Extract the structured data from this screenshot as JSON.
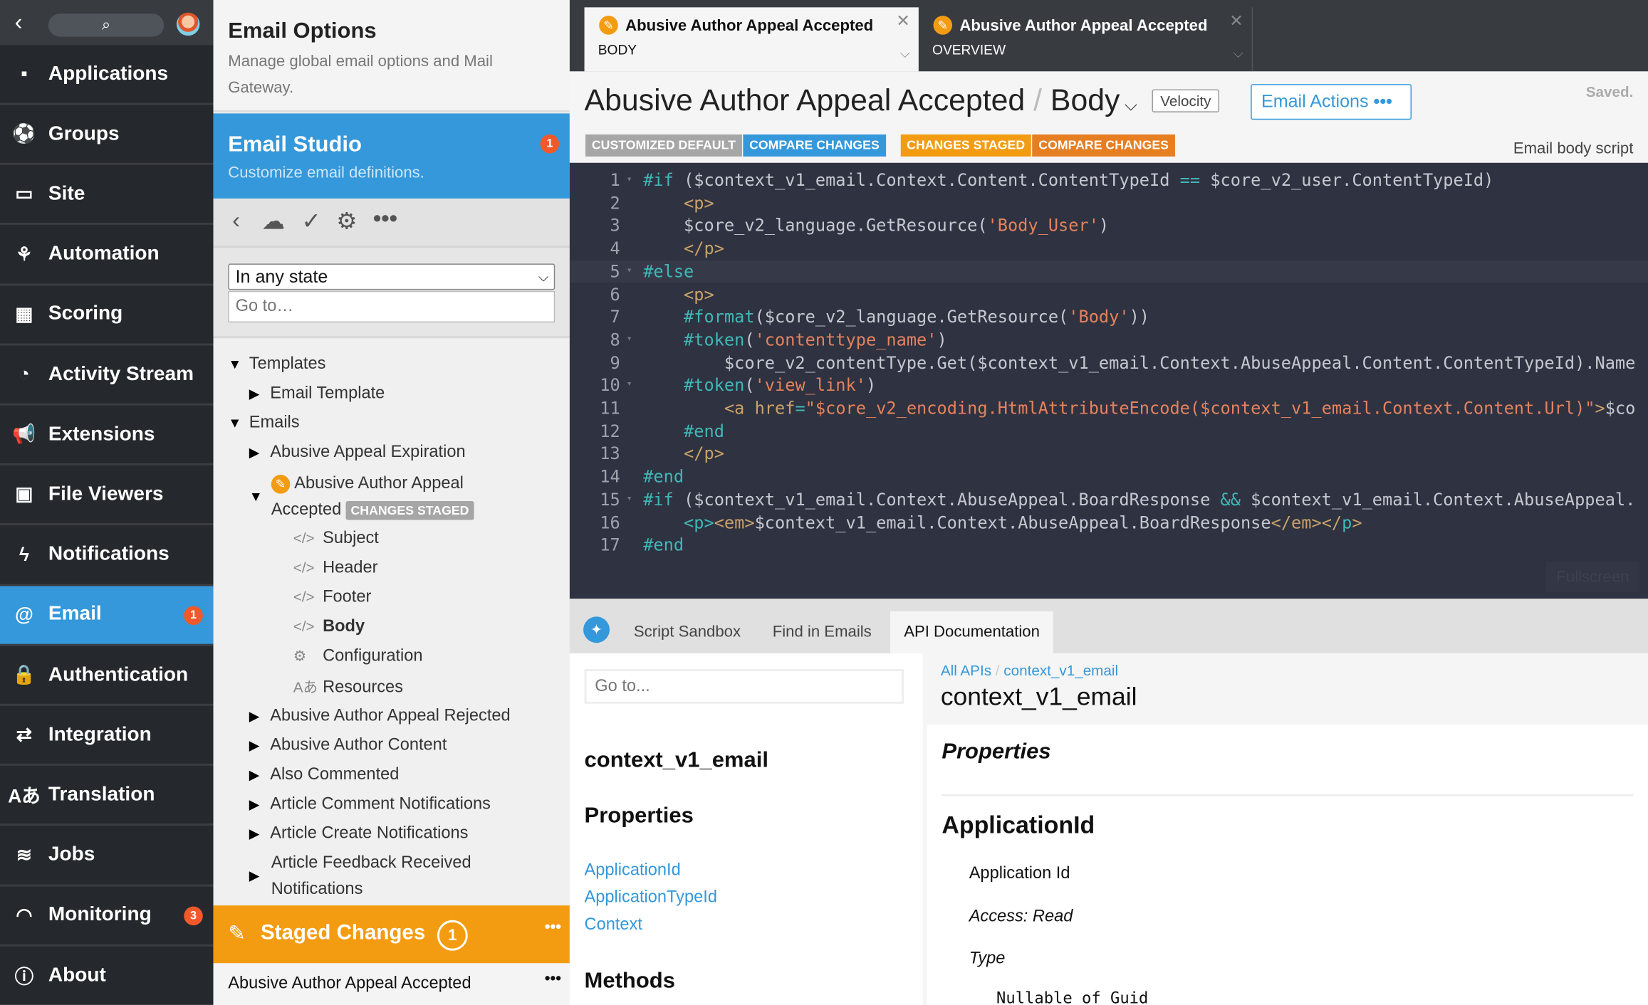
{
  "sidebar": {
    "items": [
      {
        "label": "Applications",
        "icon": "grid-icon",
        "glyph": "▪"
      },
      {
        "label": "Groups",
        "icon": "globe-icon",
        "glyph": "⚽"
      },
      {
        "label": "Site",
        "icon": "window-icon",
        "glyph": "▭"
      },
      {
        "label": "Automation",
        "icon": "hierarchy-icon",
        "glyph": "⚘"
      },
      {
        "label": "Scoring",
        "icon": "calculator-icon",
        "glyph": "▦"
      },
      {
        "label": "Activity Stream",
        "icon": "dashboard-icon",
        "glyph": "◔"
      },
      {
        "label": "Extensions",
        "icon": "megaphone-icon",
        "glyph": "📢"
      },
      {
        "label": "File Viewers",
        "icon": "camera-icon",
        "glyph": "▣"
      },
      {
        "label": "Notifications",
        "icon": "bolt-icon",
        "glyph": "ϟ"
      },
      {
        "label": "Email",
        "icon": "at-icon",
        "glyph": "@",
        "badge": "1",
        "active": true
      },
      {
        "label": "Authentication",
        "icon": "lock-icon",
        "glyph": "🔒"
      },
      {
        "label": "Integration",
        "icon": "shuffle-icon",
        "glyph": "⇄"
      },
      {
        "label": "Translation",
        "icon": "translate-icon",
        "glyph": "Aあ"
      },
      {
        "label": "Jobs",
        "icon": "database-icon",
        "glyph": "≋"
      },
      {
        "label": "Monitoring",
        "icon": "gauge-icon",
        "glyph": "◠",
        "badge": "3"
      },
      {
        "label": "About",
        "icon": "info-icon",
        "glyph": "ⓘ"
      }
    ]
  },
  "panel": {
    "title": "Email Options",
    "description": "Manage global email options and Mail Gateway.",
    "studio_title": "Email Studio",
    "studio_subtitle": "Customize email definitions.",
    "studio_badge": "1",
    "state_select": "In any state",
    "goto_placeholder": "Go to…",
    "tree": [
      {
        "label": "Templates",
        "level": 0,
        "toggle": "▼"
      },
      {
        "label": "Email Template",
        "level": 1,
        "toggle": "▶"
      },
      {
        "label": "Emails",
        "level": 0,
        "toggle": "▼"
      },
      {
        "label": "Abusive Appeal Expiration",
        "level": 1,
        "toggle": "▶"
      }
    ],
    "current_email": {
      "line1": "Abusive Author Appeal",
      "line2": "Accepted",
      "tag": "CHANGES STAGED"
    },
    "children": [
      {
        "label": "Subject",
        "icon": "code-icon",
        "glyph": "</>"
      },
      {
        "label": "Header",
        "icon": "code-icon",
        "glyph": "</>"
      },
      {
        "label": "Footer",
        "icon": "code-icon",
        "glyph": "</>"
      },
      {
        "label": "Body",
        "icon": "code-icon",
        "glyph": "</>",
        "bold": true
      },
      {
        "label": "Configuration",
        "icon": "gear-icon",
        "glyph": "⚙"
      },
      {
        "label": "Resources",
        "icon": "translate-icon",
        "glyph": "Aあ"
      }
    ],
    "more_emails": [
      "Abusive Author Appeal Rejected",
      "Abusive Author Content",
      "Also Commented",
      "Article Comment Notifications",
      "Article Create Notifications"
    ],
    "last_email": {
      "line1": "Article Feedback Received",
      "line2": "Notifications"
    },
    "staged": {
      "label": "Staged Changes",
      "count": "1",
      "item": "Abusive Author Appeal Accepted"
    }
  },
  "tabs": [
    {
      "title": "Abusive Author Appeal Accepted",
      "sub": "BODY",
      "active": true
    },
    {
      "title": "Abusive Author Appeal Accepted",
      "sub": "OVERVIEW"
    }
  ],
  "editor": {
    "title": "Abusive Author Appeal Accepted",
    "sep": "/",
    "section": "Body",
    "language": "Velocity",
    "actions": "Email Actions",
    "saved": "Saved.",
    "description": "Email body script",
    "pills": [
      {
        "label": "CUSTOMIZED DEFAULT",
        "color": "#a6a6a6"
      },
      {
        "label": "COMPARE CHANGES",
        "color": "#3498db"
      },
      {
        "label": "CHANGES STAGED",
        "color": "#f39c12"
      },
      {
        "label": "COMPARE CHANGES",
        "color": "#e67e22"
      }
    ],
    "fullscreen": "Fullscreen",
    "lines": [
      {
        "n": "1",
        "fold": true,
        "tok": [
          [
            "k",
            "#if"
          ],
          [
            "t",
            " ($context_v1_email.Context.Content.ContentTypeId "
          ],
          [
            "k",
            "=="
          ],
          [
            "t",
            " $core_v2_user.ContentTypeId)"
          ]
        ]
      },
      {
        "n": "2",
        "tok": [
          [
            "t",
            "    "
          ],
          [
            "g",
            "<p>"
          ]
        ]
      },
      {
        "n": "3",
        "tok": [
          [
            "t",
            "    $core_v2_language.GetResource("
          ],
          [
            "s",
            "'Body_User'"
          ],
          [
            "t",
            ")"
          ]
        ]
      },
      {
        "n": "4",
        "tok": [
          [
            "t",
            "    "
          ],
          [
            "g",
            "</p>"
          ]
        ]
      },
      {
        "n": "5",
        "fold": true,
        "hl": true,
        "tok": [
          [
            "k",
            "#else"
          ]
        ]
      },
      {
        "n": "6",
        "tok": [
          [
            "t",
            "    "
          ],
          [
            "g",
            "<p>"
          ]
        ]
      },
      {
        "n": "7",
        "tok": [
          [
            "t",
            "    "
          ],
          [
            "k",
            "#format"
          ],
          [
            "t",
            "($core_v2_language.GetResource("
          ],
          [
            "s",
            "'Body'"
          ],
          [
            "t",
            "))"
          ]
        ]
      },
      {
        "n": "8",
        "fold": true,
        "tok": [
          [
            "t",
            "    "
          ],
          [
            "k",
            "#token"
          ],
          [
            "t",
            "("
          ],
          [
            "s",
            "'contenttype_name'"
          ],
          [
            "t",
            ")"
          ]
        ]
      },
      {
        "n": "9",
        "tok": [
          [
            "t",
            "        $core_v2_contentType.Get($context_v1_email.Context.AbuseAppeal.Content.ContentTypeId).Name"
          ]
        ]
      },
      {
        "n": "10",
        "fold": true,
        "tok": [
          [
            "t",
            "    "
          ],
          [
            "k",
            "#token"
          ],
          [
            "t",
            "("
          ],
          [
            "s",
            "'view_link'"
          ],
          [
            "t",
            ")"
          ]
        ]
      },
      {
        "n": "11",
        "tok": [
          [
            "t",
            "        "
          ],
          [
            "g",
            "<a "
          ],
          [
            "g",
            "href"
          ],
          [
            "k",
            "="
          ],
          [
            "s",
            "\"$core_v2_encoding.HtmlAttributeEncode($context_v1_email.Context.Content.Url)\""
          ],
          [
            "g",
            ">"
          ],
          [
            "t",
            "$co"
          ]
        ]
      },
      {
        "n": "12",
        "tok": [
          [
            "t",
            "    "
          ],
          [
            "k",
            "#end"
          ]
        ]
      },
      {
        "n": "13",
        "tok": [
          [
            "t",
            "    "
          ],
          [
            "g",
            "</p>"
          ]
        ]
      },
      {
        "n": "14",
        "tok": [
          [
            "k",
            "#end"
          ]
        ]
      },
      {
        "n": "15",
        "fold": true,
        "tok": [
          [
            "k",
            "#if"
          ],
          [
            "t",
            " ($context_v1_email.Context.AbuseAppeal.BoardResponse "
          ],
          [
            "k",
            "&&"
          ],
          [
            "t",
            " $context_v1_email.Context.AbuseAppeal."
          ]
        ]
      },
      {
        "n": "16",
        "tok": [
          [
            "t",
            "    "
          ],
          [
            "k",
            "<p>"
          ],
          [
            "g",
            "<em>"
          ],
          [
            "t",
            "$context_v1_email.Context.AbuseAppeal.BoardResponse"
          ],
          [
            "g",
            "</em>"
          ],
          [
            "g",
            "</"
          ],
          [
            "k",
            "p"
          ],
          [
            "g",
            ">"
          ]
        ]
      },
      {
        "n": "17",
        "tok": [
          [
            "k",
            "#end"
          ]
        ]
      }
    ]
  },
  "bottom": {
    "tabs": [
      "Script Sandbox",
      "Find in Emails",
      "API Documentation"
    ],
    "active_tab": 2,
    "goto_placeholder": "Go to...",
    "nav": {
      "title": "context_v1_email",
      "properties_heading": "Properties",
      "properties": [
        "ApplicationId",
        "ApplicationTypeId",
        "Context"
      ],
      "methods_heading": "Methods"
    },
    "doc": {
      "breadcrumb": [
        "All APIs",
        "context_v1_email"
      ],
      "breadcrumb_sep": "/",
      "title": "context_v1_email",
      "properties_heading": "Properties",
      "prop_name": "ApplicationId",
      "prop_desc": "Application Id",
      "access": "Access: Read",
      "type_label": "Type",
      "type_value": "Nullable of Guid"
    }
  }
}
